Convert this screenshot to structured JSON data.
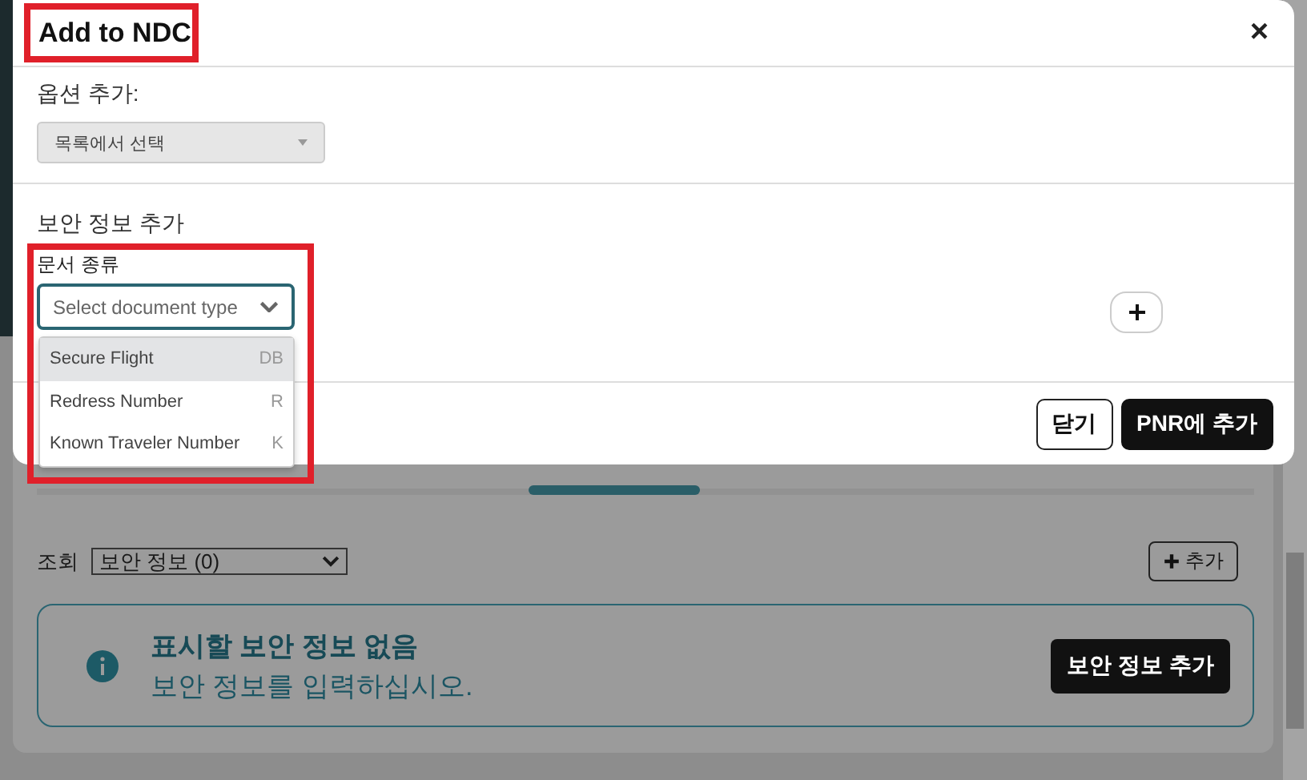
{
  "dialog": {
    "title": "Add to NDC",
    "close": "×",
    "options_label": "옵션 추가:",
    "options_select": {
      "value": "목록에서 선택"
    },
    "security_heading": "보안 정보 추가",
    "doc_type": {
      "label": "문서 종류",
      "placeholder": "Select document type",
      "expanded": true,
      "options": [
        {
          "label": "Secure Flight",
          "code": "DB",
          "selected": true
        },
        {
          "label": "Redress Number",
          "code": "R",
          "selected": false
        },
        {
          "label": "Known Traveler Number",
          "code": "K",
          "selected": false
        }
      ]
    },
    "buttons": [
      {
        "label": "닫기",
        "kind": "secondary"
      },
      {
        "label": "PNR에 추가",
        "kind": "primary"
      }
    ]
  },
  "background": {
    "view_label": "조회",
    "view_select": {
      "value": "보안 정보 (0)"
    },
    "add_button": "추가",
    "empty_state": {
      "title": "표시할 보안 정보 없음",
      "message": "보안 정보를 입력하십시오.",
      "button": "보안 정보 추가"
    }
  }
}
